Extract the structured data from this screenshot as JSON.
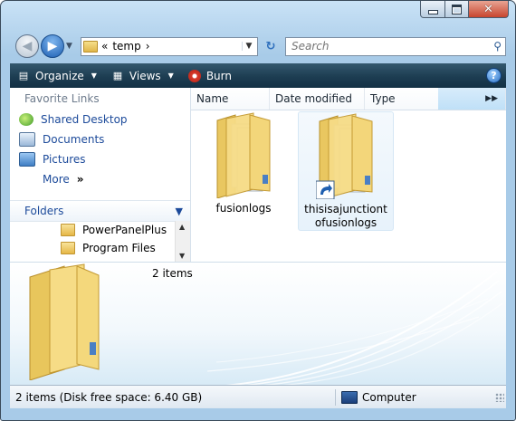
{
  "window": {
    "minimize_label": "Minimize",
    "maximize_label": "Maximize",
    "close_label": "Close"
  },
  "address": {
    "prefix": "«",
    "crumb": "temp",
    "separator": "›"
  },
  "search": {
    "placeholder": "Search"
  },
  "toolbar": {
    "organize": "Organize",
    "views": "Views",
    "burn": "Burn",
    "help": "?"
  },
  "nav": {
    "favorites_header": "Favorite Links",
    "favorites": [
      {
        "label": "Shared Desktop",
        "icon": "shared-desktop-icon"
      },
      {
        "label": "Documents",
        "icon": "documents-icon"
      },
      {
        "label": "Pictures",
        "icon": "pictures-icon"
      }
    ],
    "more": "More",
    "more_glyph": "»",
    "folders_header": "Folders",
    "tree": [
      "PowerPanelPlus",
      "Program Files"
    ]
  },
  "columns": [
    "Name",
    "Date modified",
    "Type"
  ],
  "files": [
    {
      "name": "fusionlogs",
      "shortcut": false
    },
    {
      "name": "thisisajunctiontofusionlogs",
      "shortcut": true
    }
  ],
  "details": {
    "count": "2 items"
  },
  "status": {
    "left": "2 items (Disk free space: 6.40 GB)",
    "right": "Computer"
  },
  "colors": {
    "toolbar": "#1d3d52",
    "link": "#1c4a9a",
    "accent": "#2a6fc4"
  }
}
